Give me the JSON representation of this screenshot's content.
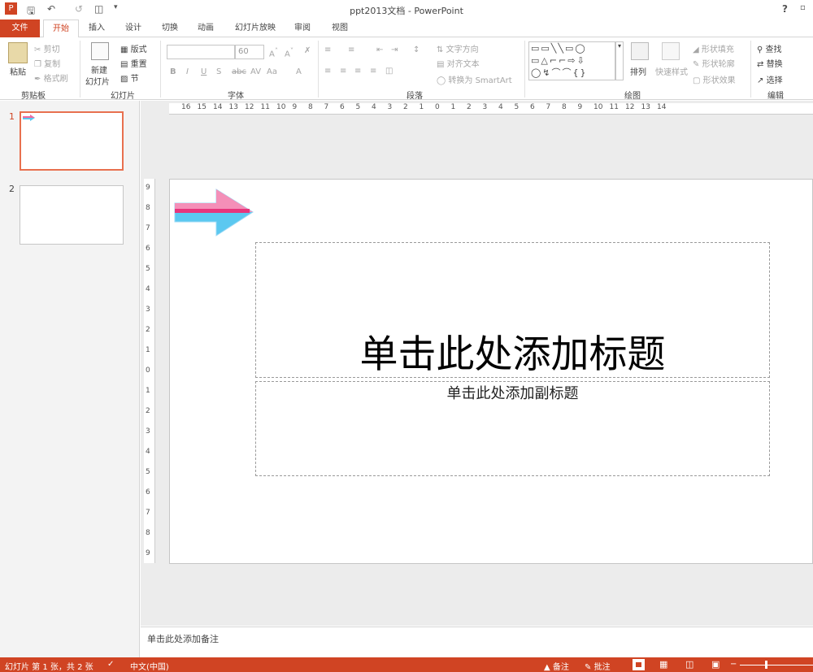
{
  "window": {
    "title": "ppt2013文档 - PowerPoint",
    "help_label": "?"
  },
  "tabs": [
    "文件",
    "开始",
    "插入",
    "设计",
    "切换",
    "动画",
    "幻灯片放映",
    "审阅",
    "视图"
  ],
  "ribbon": {
    "clipboard": {
      "label": "剪贴板",
      "paste": "粘贴",
      "cut": "剪切",
      "copy": "复制",
      "format_painter": "格式刷"
    },
    "slides": {
      "label": "幻灯片",
      "new_slide_1": "新建",
      "new_slide_2": "幻灯片",
      "layout": "版式",
      "reset": "重置",
      "section": "节"
    },
    "font": {
      "label": "字体",
      "font_size": "60"
    },
    "paragraph": {
      "label": "段落",
      "text_direction": "文字方向",
      "align_text": "对齐文本",
      "smartart": "转换为 SmartArt"
    },
    "drawing": {
      "label": "绘图",
      "arrange": "排列",
      "quick_styles": "快速样式",
      "shape_fill": "形状填充",
      "shape_outline": "形状轮廓",
      "shape_effects": "形状效果"
    },
    "editing": {
      "label": "编辑",
      "find": "查找",
      "replace": "替换",
      "select": "选择"
    }
  },
  "slides_panel": {
    "items": [
      {
        "number": "1"
      },
      {
        "number": "2"
      }
    ]
  },
  "ruler": {
    "horizontal": [
      "16",
      "15",
      "14",
      "13",
      "12",
      "11",
      "10",
      "9",
      "8",
      "7",
      "6",
      "5",
      "4",
      "3",
      "2",
      "1",
      "0",
      "1",
      "2",
      "3",
      "4",
      "5",
      "6",
      "7",
      "8",
      "9",
      "10",
      "11",
      "12",
      "13",
      "14"
    ],
    "vertical": [
      "9",
      "8",
      "7",
      "6",
      "5",
      "4",
      "3",
      "2",
      "1",
      "0",
      "1",
      "2",
      "3",
      "4",
      "5",
      "6",
      "7",
      "8",
      "9"
    ]
  },
  "slide": {
    "title_placeholder": "单击此处添加标题",
    "subtitle_placeholder": "单击此处添加副标题",
    "arrow_colors": {
      "pink": "#f06aa0",
      "blue": "#5bc8f0"
    }
  },
  "notes": {
    "placeholder": "单击此处添加备注"
  },
  "status": {
    "slide_info": "幻灯片 第 1 张，共 2 张",
    "language": "中文(中国)",
    "notes_btn": "备注",
    "comments_btn": "批注"
  },
  "colors": {
    "accent": "#d04423",
    "highlight_box": "#e8161b"
  }
}
